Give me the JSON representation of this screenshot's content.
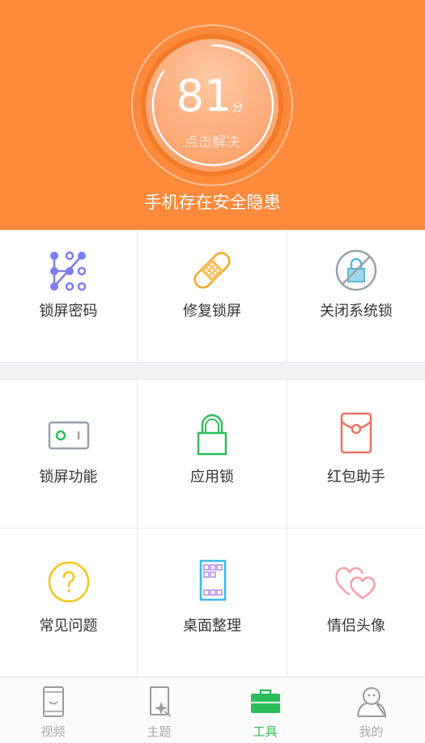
{
  "header": {
    "score": "81",
    "score_unit": "分",
    "score_action": "点击解决",
    "warning": "手机存在安全隐患",
    "background_color": "#fd8a3b"
  },
  "tools": [
    {
      "label": "锁屏密码",
      "icon": "pattern-lock-icon",
      "color": "#7b7cf0"
    },
    {
      "label": "修复锁屏",
      "icon": "bandage-icon",
      "color": "#f5a623"
    },
    {
      "label": "关闭系统锁",
      "icon": "lock-disabled-icon",
      "color": "#5bb8d8"
    },
    {
      "label": "锁屏功能",
      "icon": "toggle-switch-icon",
      "color": "#9aa0aa"
    },
    {
      "label": "应用锁",
      "icon": "padlock-icon",
      "color": "#2cbd5a"
    },
    {
      "label": "红包助手",
      "icon": "red-envelope-icon",
      "color": "#f07060"
    },
    {
      "label": "常见问题",
      "icon": "question-circle-icon",
      "color": "#f5c518"
    },
    {
      "label": "桌面整理",
      "icon": "desktop-grid-icon",
      "color": "#3db8e8"
    },
    {
      "label": "情侣头像",
      "icon": "couple-hearts-icon",
      "color": "#f7a0a8"
    }
  ],
  "bottom_nav": [
    {
      "label": "视频",
      "icon": "video-phone-icon",
      "active": false
    },
    {
      "label": "主题",
      "icon": "theme-sparkle-icon",
      "active": false
    },
    {
      "label": "工具",
      "icon": "toolbox-icon",
      "active": true
    },
    {
      "label": "我的",
      "icon": "user-profile-icon",
      "active": false
    }
  ],
  "accent_color": "#2cbd5a"
}
